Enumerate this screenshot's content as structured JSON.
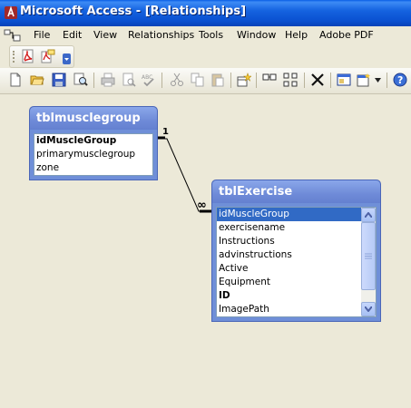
{
  "window": {
    "title": "Microsoft Access - [Relationships]"
  },
  "menu": [
    "File",
    "Edit",
    "View",
    "Relationships",
    "Tools",
    "Window",
    "Help",
    "Adobe PDF"
  ],
  "tables": [
    {
      "name": "tblmusclegroup",
      "fields": [
        "idMuscleGroup",
        "primarymusclegroup",
        "zone"
      ],
      "primary_key": "idMuscleGroup"
    },
    {
      "name": "tblExercise",
      "fields": [
        "idMuscleGroup",
        "exercisename",
        "Instructions",
        "advinstructions",
        "Active",
        "Equipment",
        "ID",
        "ImagePath"
      ],
      "primary_key": "ID",
      "selected_field": "idMuscleGroup"
    }
  ],
  "relationship": {
    "one_label": "1",
    "many_label": "∞"
  },
  "toolbar_icons": [
    "new-icon",
    "open-icon",
    "save-icon",
    "search-icon",
    "print-icon",
    "print-preview-icon",
    "spelling-icon",
    "cut-icon",
    "copy-icon",
    "paste-icon",
    "show-table-icon",
    "show-direct-icon",
    "show-all-icon",
    "delete-icon",
    "database-window-icon",
    "new-object-icon",
    "help-icon"
  ],
  "pdf_toolbar_icons": [
    "convert-to-pdf-icon",
    "convert-and-email-icon"
  ]
}
